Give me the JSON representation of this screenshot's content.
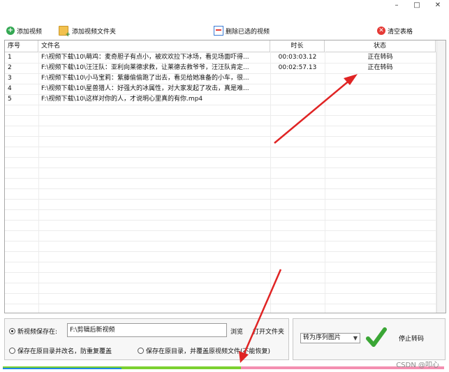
{
  "window": {
    "minimize": "–",
    "maximize": "□",
    "close": "✕"
  },
  "toolbar": {
    "add_video": "添加视频",
    "add_folder": "添加视频文件夹",
    "delete_selected": "删除已选的视频",
    "clear_table": "清空表格"
  },
  "table": {
    "headers": {
      "index": "序号",
      "filename": "文件名",
      "duration": "时长",
      "status": "状态"
    },
    "rows": [
      {
        "index": "1",
        "filename": "F:\\视频下载\\10\\萌鸡：麦奇胆子有点小，被欢欢拉下冰场，看见场面吓得...",
        "duration": "00:03:03.12",
        "status": "正在转码"
      },
      {
        "index": "2",
        "filename": "F:\\视频下载\\10\\汪汪队：亚利向莱德求救，让莱德去救爷爷，汪汪队肯定...",
        "duration": "00:02:57.13",
        "status": "正在转码"
      },
      {
        "index": "3",
        "filename": "F:\\视频下载\\10\\小马宝莉：紫藤偷偷跑了出去，看见给她准备的小车，很...",
        "duration": "",
        "status": ""
      },
      {
        "index": "4",
        "filename": "F:\\视频下载\\10\\星兽猎人：好强大的冰属性，对大家发起了攻击，真是难...",
        "duration": "",
        "status": ""
      },
      {
        "index": "5",
        "filename": "F:\\视频下载\\10\\这样对你的人，才说明心里真的有你.mp4",
        "duration": "",
        "status": ""
      }
    ]
  },
  "output": {
    "new_location_label": "新视频保存在:",
    "path_value": "F:\\剪辑后新视频",
    "browse": "浏览",
    "open_folder": "打开文件夹",
    "keep_rename": "保存在原目录并改名，防重复覆盖",
    "overwrite": "保存在原目录，并覆盖原视频文件(不能恢复)"
  },
  "convert": {
    "mode_selected": "转为序列图片",
    "stop_label": "停止转码"
  },
  "progress": {
    "value": 0.54
  },
  "watermark": "CSDN @叩心",
  "colors": {
    "accent_green": "#7bd130",
    "progress_pink": "#f48fb1",
    "arrow_red": "#e02424",
    "status_blue": "#1e88e5"
  }
}
